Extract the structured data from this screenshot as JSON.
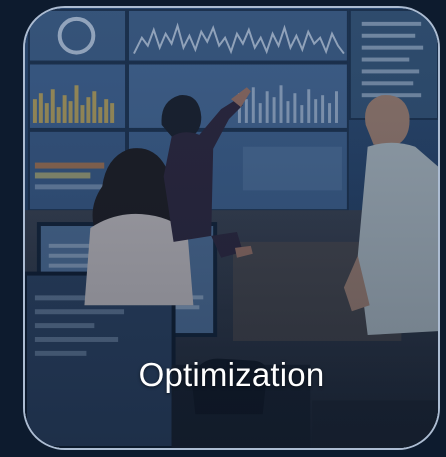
{
  "card": {
    "title": "Optimization"
  },
  "colors": {
    "page_background": "#0d1b2e",
    "card_border": "#c4d3e6",
    "overlay_tint": "#1f3d66",
    "caption_text": "#ffffff"
  }
}
